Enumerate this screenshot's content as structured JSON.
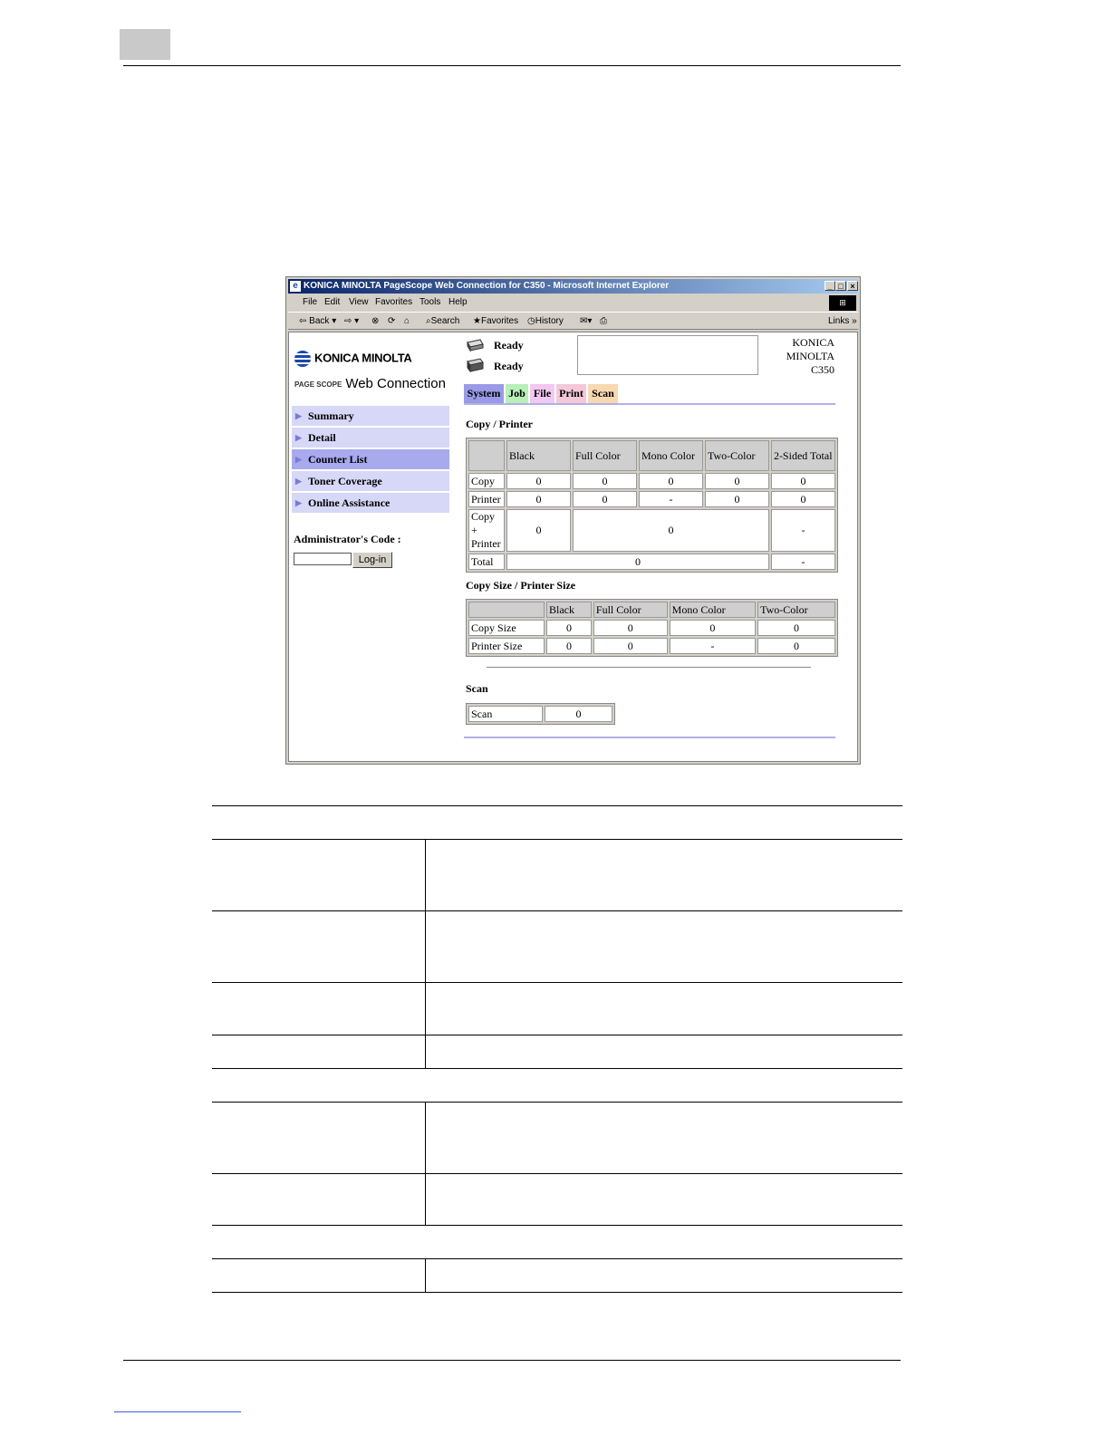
{
  "browser": {
    "title": "KONICA MINOLTA PageScope Web Connection for C350 - Microsoft Internet Explorer",
    "controls": [
      "_",
      "□",
      "×"
    ],
    "menu": [
      "File",
      "Edit",
      "View",
      "Favorites",
      "Tools",
      "Help"
    ],
    "toolbar": {
      "back": "Back",
      "search": "Search",
      "favorites": "Favorites",
      "history": "History",
      "links": "Links"
    }
  },
  "app": {
    "brand": "KONICA MINOLTA",
    "product": "Web Connection",
    "pagescope": "PAGE SCOPE",
    "status": [
      "Ready",
      "Ready"
    ],
    "model": [
      "KONICA",
      "MINOLTA",
      "C350"
    ],
    "tabs": [
      "System",
      "Job",
      "File",
      "Print",
      "Scan"
    ],
    "nav": [
      "Summary",
      "Detail",
      "Counter List",
      "Toner Coverage",
      "Online Assistance"
    ],
    "admin_label": "Administrator's Code :",
    "login": "Log-in"
  },
  "copy_printer": {
    "title": "Copy / Printer",
    "headers": [
      "Black",
      "Full Color",
      "Mono Color",
      "Two-Color",
      "2-Sided Total"
    ],
    "rows": {
      "copy": {
        "label": "Copy",
        "values": [
          "0",
          "0",
          "0",
          "0",
          "0"
        ]
      },
      "printer": {
        "label": "Printer",
        "values": [
          "0",
          "0",
          "-",
          "0",
          "0"
        ]
      },
      "copy_printer": {
        "label_1": "Copy",
        "label_2": "+",
        "label_3": "Printer",
        "black": "0",
        "color": "0",
        "two_sided": "-"
      },
      "total": {
        "label": "Total",
        "value": "0",
        "two_sided": "-"
      }
    }
  },
  "size": {
    "title": "Copy Size / Printer Size",
    "headers": [
      "Black",
      "Full Color",
      "Mono Color",
      "Two-Color"
    ],
    "rows": [
      {
        "label": "Copy Size",
        "values": [
          "0",
          "0",
          "0",
          "0"
        ]
      },
      {
        "label": "Printer Size",
        "values": [
          "0",
          "0",
          "-",
          "0"
        ]
      }
    ]
  },
  "scan": {
    "title": "Scan",
    "label": "Scan",
    "value": "0"
  }
}
